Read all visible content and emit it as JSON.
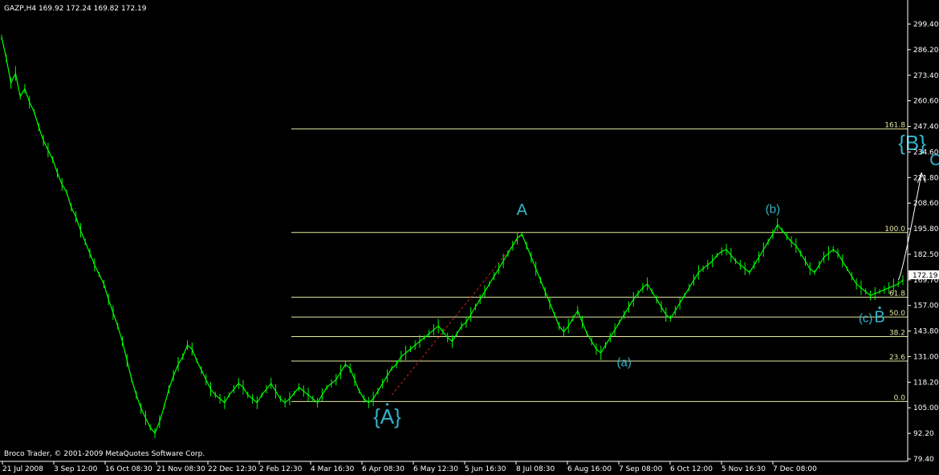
{
  "header": {
    "symbol_info": "GAZP,H4  169.92 172.24 169.82 172.19",
    "copyright": "Broco Trader, © 2001-2009 MetaQuotes Software Corp."
  },
  "colors": {
    "background": "#000000",
    "price_line": "#00ff00",
    "fib_line": "#e8e8a0",
    "wave_label": "#33b4c8",
    "axis": "#ffffff",
    "trendline": "#cc2222",
    "projection": "#ffffff"
  },
  "chart_data": {
    "type": "line",
    "title": "",
    "current_price": "172.19",
    "ylim": [
      79.4,
      310
    ],
    "y_ticks": [
      "299.40",
      "286.20",
      "273.40",
      "260.60",
      "247.40",
      "234.60",
      "221.80",
      "208.60",
      "195.80",
      "182.50",
      "169.70",
      "157.00",
      "143.80",
      "131.00",
      "118.20",
      "105.00",
      "92.20",
      "79.40"
    ],
    "x_ticks": [
      "21 Jul 2008",
      "3 Sep 12:00",
      "16 Oct 08:30",
      "21 Nov 08:30",
      "22 Dec 12:30",
      "2 Feb 12:30",
      "4 Mar 16:30",
      "6 Apr 08:30",
      "6 May 12:30",
      "5 Jun 16:30",
      "8 Jul 08:30",
      "6 Aug 16:00",
      "7 Sep 08:00",
      "6 Oct 12:00",
      "5 Nov 16:30",
      "7 Dec 08:00"
    ],
    "series": [
      {
        "values": [
          299,
          288,
          275,
          280,
          268,
          272,
          265,
          260,
          252,
          245,
          240,
          235,
          228,
          222,
          218,
          210,
          205,
          198,
          192,
          186,
          180,
          175,
          170,
          162,
          155,
          148,
          140,
          130,
          120,
          112,
          105,
          100,
          95,
          92,
          98,
          106,
          115,
          122,
          128,
          132,
          138,
          136,
          130,
          125,
          120,
          115,
          112,
          110,
          108,
          112,
          115,
          118,
          116,
          112,
          110,
          108,
          112,
          115,
          118,
          114,
          110,
          108,
          110,
          113,
          116,
          114,
          112,
          110,
          108,
          112,
          116,
          118,
          120,
          124,
          128,
          126,
          120,
          114,
          110,
          108,
          110,
          114,
          118,
          122,
          126,
          128,
          132,
          134,
          136,
          138,
          140,
          142,
          144,
          146,
          148,
          145,
          142,
          140,
          144,
          148,
          150,
          154,
          158,
          162,
          166,
          170,
          174,
          178,
          182,
          186,
          190,
          194,
          196,
          190,
          184,
          178,
          172,
          166,
          160,
          154,
          148,
          145,
          148,
          152,
          156,
          150,
          144,
          140,
          136,
          134,
          138,
          142,
          146,
          150,
          154,
          158,
          162,
          165,
          168,
          170,
          166,
          162,
          158,
          154,
          152,
          156,
          160,
          164,
          168,
          172,
          176,
          178,
          180,
          182,
          185,
          187,
          188,
          185,
          182,
          180,
          178,
          176,
          180,
          184,
          188,
          192,
          196,
          201,
          198,
          195,
          192,
          190,
          186,
          182,
          178,
          176,
          180,
          184,
          186,
          188,
          186,
          182,
          178,
          174,
          170,
          168,
          166,
          164,
          165,
          166,
          167,
          168,
          169,
          170,
          172
        ]
      }
    ],
    "fibonacci_levels": [
      {
        "label": "161.8",
        "value": 251.0
      },
      {
        "label": "100.0",
        "value": 196.9
      },
      {
        "label": "61.8",
        "value": 163.1
      },
      {
        "label": "50.0",
        "value": 152.7
      },
      {
        "label": "38.2",
        "value": 142.5
      },
      {
        "label": "23.6",
        "value": 129.7
      },
      {
        "label": "0.0",
        "value": 108.6
      }
    ],
    "wave_labels": [
      {
        "text": "{A}",
        "kind": "major",
        "x_index": 83,
        "value": 97
      },
      {
        "text": "A",
        "kind": "minor",
        "x_index": 112,
        "value": 206
      },
      {
        "text": "(a)",
        "kind": "small",
        "x_index": 134,
        "value": 127
      },
      {
        "text": "(b)",
        "kind": "small",
        "x_index": 166,
        "value": 207
      },
      {
        "text": "(c)",
        "kind": "small",
        "x_index": 186,
        "value": 150
      },
      {
        "text": "B",
        "kind": "minor",
        "x_index": 189,
        "value": 150
      },
      {
        "text": "{B}",
        "kind": "major",
        "x_index": 196,
        "value": 240
      },
      {
        "text": "C",
        "kind": "minor",
        "x_index": 201,
        "value": 232
      }
    ],
    "projection": [
      {
        "x_index": 193,
        "value": 172
      },
      {
        "x_index": 198,
        "value": 228
      }
    ],
    "trendline": [
      {
        "x_index": 84,
        "value": 112
      },
      {
        "x_index": 112,
        "value": 196
      }
    ]
  }
}
